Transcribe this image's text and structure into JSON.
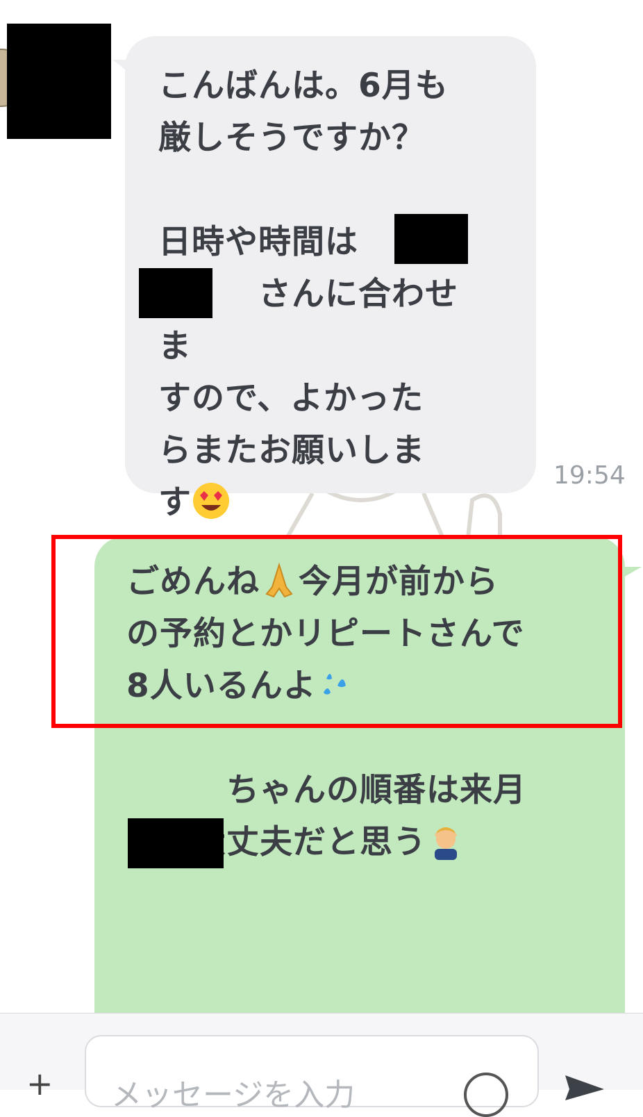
{
  "incoming": {
    "text": "こんばんは。6月も\n厳しそうですか？\n\n日時や時間は\n　　　さんに合わせま\nすので、よかった\nらまたお願いしま\nす",
    "time": "19:54",
    "emoji": "heart-eyes-emoji"
  },
  "outgoing": {
    "line1": "ごめんね",
    "line1b": "今月が前から\nの予約とかリピートさんで\n8人いるんよ",
    "line2": "\n\n　　　ちゃんの順番は来月\nには大丈夫だと思う",
    "emojis": [
      "folded-hands-emoji",
      "sweat-droplets-emoji",
      "person-ok-gesture-emoji"
    ]
  },
  "input": {
    "placeholder": "メッセージを入力",
    "plus": "+"
  },
  "colors": {
    "incoming_bubble": "#efeff1",
    "outgoing_bubble": "#c2e8bd",
    "highlight": "#ff0000",
    "redaction": "#000000"
  }
}
